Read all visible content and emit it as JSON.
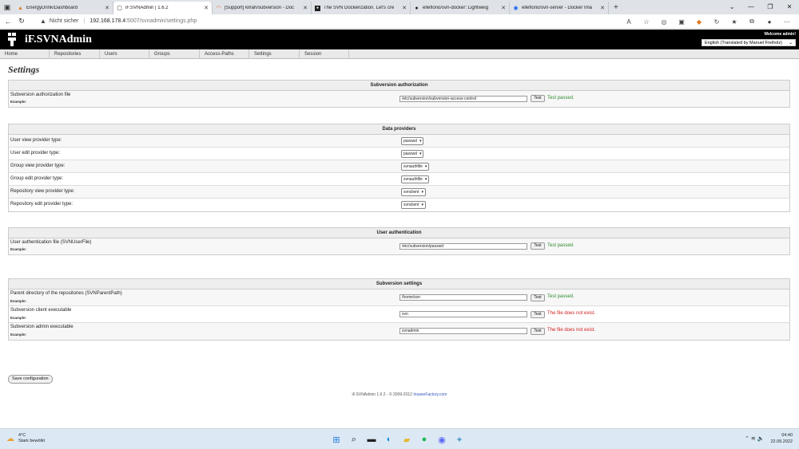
{
  "browser": {
    "tabs": [
      {
        "label": "EnergyDrink/Dashboard",
        "icon": "warning-triangle-icon",
        "active": false
      },
      {
        "label": "iF.SVNAdmin | 1.6.2",
        "icon": "page-icon",
        "active": true
      },
      {
        "label": "[Support] kilrah/subversion - Doc",
        "icon": "unraid-icon",
        "active": false
      },
      {
        "label": "The SVN Dockerization. Let's cre",
        "icon": "medium-icon",
        "active": false
      },
      {
        "label": "elleflorio/svn-docker: Lightweig",
        "icon": "github-icon",
        "active": false
      },
      {
        "label": "elleflorio/svn-server - Docker Ima",
        "icon": "docker-icon",
        "active": false
      }
    ],
    "security_label": "Nicht sicher",
    "url_host": "192.168.178.4",
    "url_rest": ":5007/svnadmin/settings.php"
  },
  "header": {
    "title": "iF.SVNAdmin",
    "welcome": "Welcome admin!",
    "language": "English (Translated by Manuel Freiholz)"
  },
  "menu": [
    "Home",
    "Repositories",
    "Users",
    "Groups",
    "Access-Paths",
    "Settings",
    "Session"
  ],
  "page_title": "Settings",
  "sections": {
    "authz": {
      "title": "Subversion authorization",
      "rows": [
        {
          "label": "Subversion authorization file",
          "example": "Example:",
          "value": "/etc/subversion/subversion-access-control",
          "test": "Test",
          "status": "Test passed."
        }
      ]
    },
    "providers": {
      "title": "Data providers",
      "rows": [
        {
          "label": "User view provider type:",
          "value": "passwd"
        },
        {
          "label": "User edit provider type:",
          "value": "passwd"
        },
        {
          "label": "Group view provider type:",
          "value": "svnauthfile"
        },
        {
          "label": "Group edit provider type:",
          "value": "svnauthfile"
        },
        {
          "label": "Repository view provider type:",
          "value": "svnclient"
        },
        {
          "label": "Repository edit provider type:",
          "value": "svnclient"
        }
      ]
    },
    "userauth": {
      "title": "User authentication",
      "rows": [
        {
          "label": "User authentication file (SVNUserFile)",
          "example": "Example:",
          "value": "/etc/subversion/passwd",
          "test": "Test",
          "status": "Test passed."
        }
      ]
    },
    "svn": {
      "title": "Subversion settings",
      "rows": [
        {
          "label": "Parent directory of the repositories (SVNParentPath)",
          "example": "Example:",
          "value": "/home/svn",
          "test": "Test",
          "status": "Test passed."
        },
        {
          "label": "Subversion client executable",
          "example": "Example:",
          "value": "svn",
          "test": "Test",
          "status": "The file does not exist."
        },
        {
          "label": "Subversion admin executable",
          "example": "Example:",
          "value": "svnadmin",
          "test": "Test",
          "status": "The file does not exist."
        }
      ]
    }
  },
  "save_label": "Save configuration",
  "footer": {
    "prefix": "iF.SVNAdmin 1.6.2 - © 2009-2012 ",
    "link": "InsaneFactory.com"
  },
  "taskbar": {
    "weather_temp": "4°C",
    "weather_desc": "Stark bewölkt",
    "time": "04:40",
    "date": "22.09.2022"
  },
  "colors": {
    "ok": "#2e8b2e",
    "error": "#d0201e"
  }
}
